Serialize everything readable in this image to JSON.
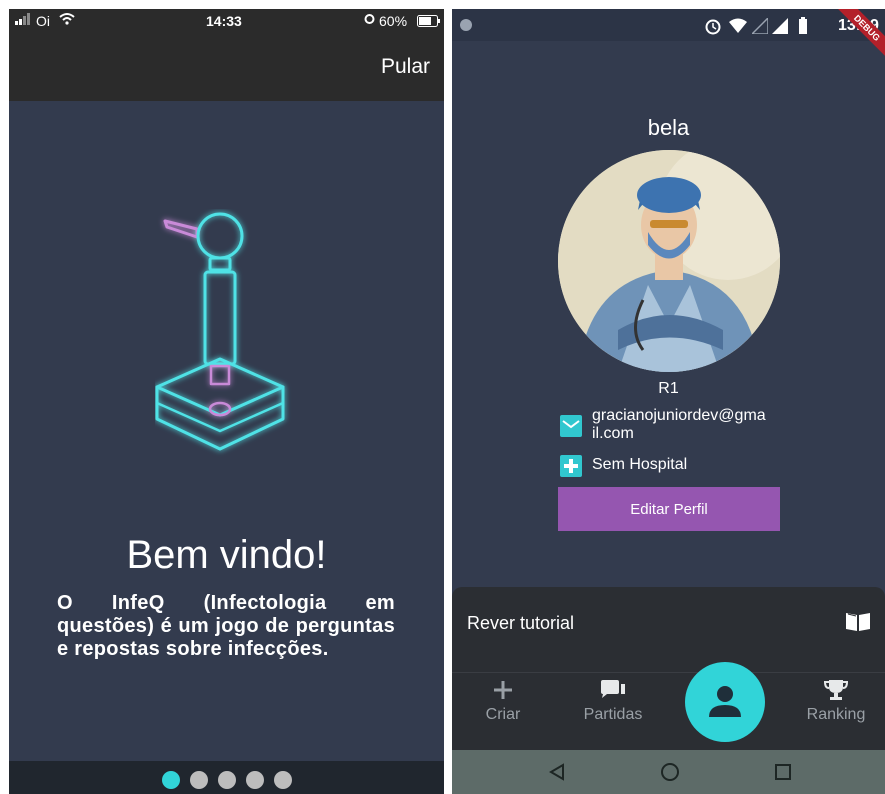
{
  "left": {
    "status": {
      "carrier": "Oi",
      "time": "14:33",
      "battery": "60%"
    },
    "skip_label": "Pular",
    "title": "Bem vindo!",
    "description": "O InfeQ (Infectologia em questões) é um jogo de perguntas e repostas sobre infecções.",
    "page_dots": {
      "count": 5,
      "active_index": 0
    },
    "colors": {
      "accent": "#31d4d8",
      "background": "#333b4e",
      "bar": "#2b2b2b"
    }
  },
  "right": {
    "status": {
      "time": "13:29",
      "debug_banner": "DEBUG"
    },
    "profile": {
      "name": "bela",
      "rank": "R1",
      "email": "gracianojuniordev@gmail.com",
      "email_line1": "gracianojuniordev@gma",
      "email_line2": "il.com",
      "hospital": "Sem Hospital",
      "edit_label": "Editar Perfil"
    },
    "sheet": {
      "tutorial_label": "Rever tutorial",
      "tutorial_icon": "book-icon"
    },
    "bottom_nav": [
      {
        "label": "Criar",
        "icon": "plus-icon"
      },
      {
        "label": "Partidas",
        "icon": "chat-icon"
      },
      {
        "label": "",
        "icon": "person-icon"
      },
      {
        "label": "Ranking",
        "icon": "trophy-icon"
      }
    ],
    "system_nav": [
      "back-icon",
      "home-icon",
      "recents-icon"
    ],
    "colors": {
      "accent": "#31d4d8",
      "button": "#9556b0",
      "icon": "#31c7cf"
    }
  }
}
